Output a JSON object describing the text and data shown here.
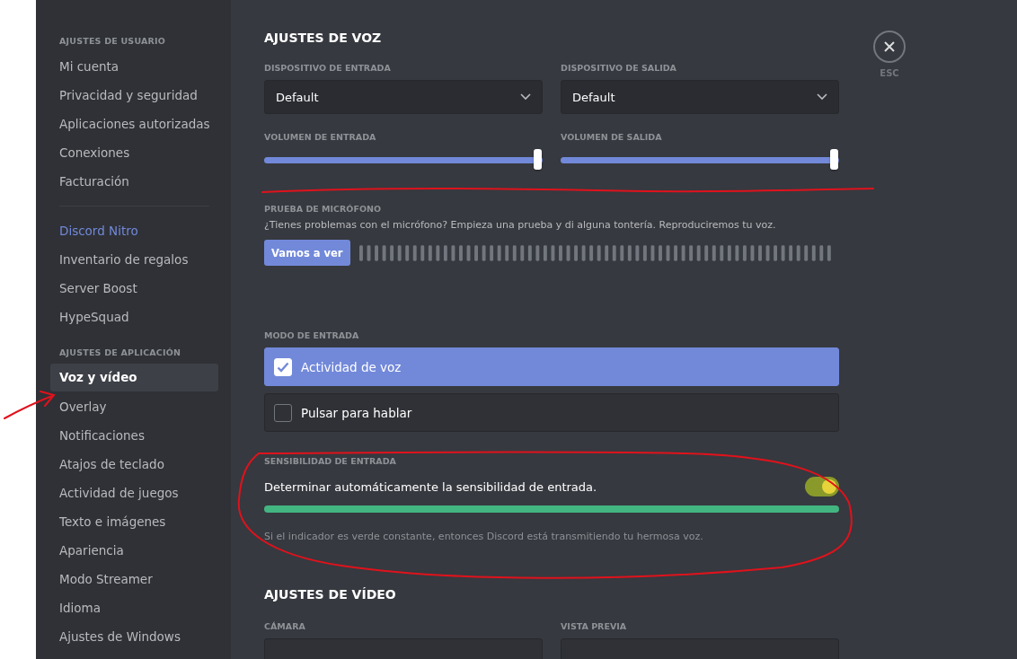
{
  "sidebar": {
    "sections": [
      {
        "header": "AJUSTES DE USUARIO",
        "items": [
          {
            "label": "Mi cuenta",
            "selected": false,
            "kind": "normal"
          },
          {
            "label": "Privacidad y seguridad",
            "selected": false,
            "kind": "normal"
          },
          {
            "label": "Aplicaciones autorizadas",
            "selected": false,
            "kind": "normal"
          },
          {
            "label": "Conexiones",
            "selected": false,
            "kind": "normal"
          },
          {
            "label": "Facturación",
            "selected": false,
            "kind": "normal"
          }
        ]
      },
      {
        "items": [
          {
            "label": "Discord Nitro",
            "selected": false,
            "kind": "nitro"
          },
          {
            "label": "Inventario de regalos",
            "selected": false,
            "kind": "normal"
          },
          {
            "label": "Server Boost",
            "selected": false,
            "kind": "normal"
          },
          {
            "label": "HypeSquad",
            "selected": false,
            "kind": "normal"
          }
        ]
      },
      {
        "header": "AJUSTES DE APLICACIÓN",
        "items": [
          {
            "label": "Voz y vídeo",
            "selected": true,
            "kind": "normal"
          },
          {
            "label": "Overlay",
            "selected": false,
            "kind": "normal"
          },
          {
            "label": "Notificaciones",
            "selected": false,
            "kind": "normal"
          },
          {
            "label": "Atajos de teclado",
            "selected": false,
            "kind": "normal"
          },
          {
            "label": "Actividad de juegos",
            "selected": false,
            "kind": "normal"
          },
          {
            "label": "Texto e imágenes",
            "selected": false,
            "kind": "normal"
          },
          {
            "label": "Apariencia",
            "selected": false,
            "kind": "normal"
          },
          {
            "label": "Modo Streamer",
            "selected": false,
            "kind": "normal"
          },
          {
            "label": "Idioma",
            "selected": false,
            "kind": "normal"
          },
          {
            "label": "Ajustes de Windows",
            "selected": false,
            "kind": "normal"
          }
        ]
      }
    ]
  },
  "voice": {
    "title": "AJUSTES DE VOZ",
    "devices": [
      {
        "label": "DISPOSITIVO DE ENTRADA",
        "value": "Default"
      },
      {
        "label": "DISPOSITIVO DE SALIDA",
        "value": "Default"
      }
    ],
    "volumes": [
      {
        "label": "VOLUMEN DE ENTRADA",
        "level": 1
      },
      {
        "label": "VOLUMEN DE SALIDA",
        "level": 1
      }
    ],
    "mic_test": {
      "label": "PRUEBA DE MICRÓFONO",
      "description": "¿Tienes problemas con el micrófono? Empieza una prueba y di alguna tontería. Reproduciremos tu voz.",
      "button": "Vamos a ver"
    },
    "input_mode": {
      "label": "MODO DE ENTRADA",
      "options": [
        {
          "label": "Actividad de voz",
          "selected": true
        },
        {
          "label": "Pulsar para hablar",
          "selected": false
        }
      ]
    },
    "sensitivity": {
      "label": "SENSIBILIDAD DE ENTRADA",
      "auto_label": "Determinar automáticamente la sensibilidad de entrada.",
      "auto_on": true,
      "level": 1,
      "hint": "Si el indicador es verde constante, entonces Discord está transmitiendo tu hermosa voz."
    }
  },
  "video": {
    "title": "AJUSTES DE VÍDEO",
    "columns": [
      {
        "label": "CÁMARA"
      },
      {
        "label": "VISTA PREVIA"
      }
    ]
  },
  "close": {
    "label": "ESC"
  }
}
